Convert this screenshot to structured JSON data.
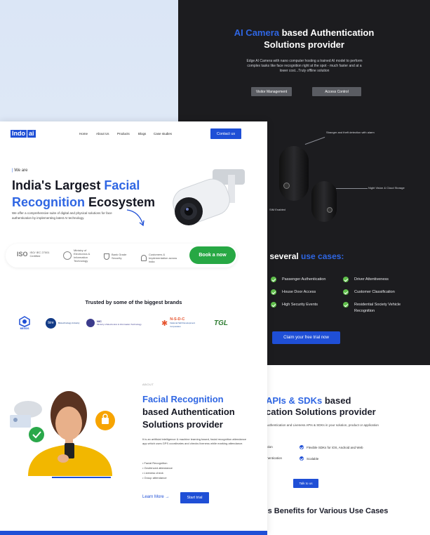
{
  "colors": {
    "accent": "#2f66e3",
    "button": "#1f4fd6",
    "green": "#27a844",
    "dark_bg": "#1c1c1f"
  },
  "back_page": {
    "hero": {
      "title_highlight": "AI Camera",
      "title_rest_line1": " based Authentication",
      "title_line2": "Solutions provider",
      "description": "Edge AI Camera with nano computer hosting a trained AI model to perform complex tasks like face recognition right at the spot - much faster and at a lower cost...Truly offline solution"
    },
    "tabs": [
      "Visitor Management",
      "Access Control"
    ],
    "callouts": {
      "stranger": "Stranger and theft detection with alarm",
      "night": "Night Vision & Cloud Storage",
      "sim": "SIM Enabled"
    },
    "use_cases": {
      "title_prefix": "ur several ",
      "title_highlight": "use cases:",
      "left": [
        "Passenger Authentication",
        "House Door Access",
        "High Security Events"
      ],
      "right": [
        "Driver Attentiveness",
        "Customer Classification",
        "Residential Society Vehicle Recognition"
      ],
      "cta": "Claim your free trial now"
    },
    "apis": {
      "title_line1_highlight": "APIs & SDKs",
      "title_line1_rest": " based",
      "title_line2": "cation Solutions provider",
      "subtitle": "Authentication and Liveness APIs & SDKs in your solution, product or application",
      "features_left": [
        "ation",
        "thentication"
      ],
      "features_right": [
        "Flexible SDKs for iOS, Android and Web",
        "Scalable"
      ],
      "cta": "Talk to us"
    },
    "benefits": {
      "title_rest": "'s Benefits for Various ",
      "title_end": "Use Cases"
    }
  },
  "front_page": {
    "logo": {
      "part1": "Indo",
      "part2": "ai"
    },
    "nav": [
      "Home",
      "About Us",
      "Products",
      "Blogs",
      "Case studies"
    ],
    "contact_button": "Contact us",
    "hero": {
      "eyebrow": "We are",
      "line1": "India's Largest ",
      "line1_highlight": "Facial",
      "line2_highlight": "Recognition",
      "line2_rest": " Ecosystem",
      "subtitle": "We offer a comprehensive suite of digital and physical solutions for face authentication by implementing latest AI technology."
    },
    "trust_badges": [
      {
        "icon": "iso-badge-icon",
        "text": "ISO/ IEC 27001 Certified"
      },
      {
        "icon": "ministry-emblem-icon",
        "text": "Ministry of Electronics & Information Technology"
      },
      {
        "icon": "shield-check-icon",
        "text": "Bank Grade Security"
      },
      {
        "icon": "user-check-icon",
        "text": "Customers & Implementation across india"
      }
    ],
    "book_button": "Book a now",
    "brands_title": "Trusted by some of the biggest brands",
    "brands": [
      {
        "name": "MEGDS"
      },
      {
        "name": "bire",
        "sub": "Biotechnology Industry"
      },
      {
        "name": "NIC",
        "sub": "Ministry of Electronics & Information Technology"
      },
      {
        "name": "N-S-D-C",
        "sub": "National Skill Development Corporation"
      },
      {
        "name": "TGL"
      }
    ],
    "about": {
      "eyebrow": "ABOUT",
      "title_highlight": "Facial Recognition",
      "title_line2": "based Authentication",
      "title_line3": "Solutions provider",
      "description": "It is an artificial intelligence & machine learning based, facial recognition attendance app which uses GPS coordinates and checks liveness while marking attendance.",
      "list": [
        "Facial Recognition",
        "Geofenced attendance",
        "Liveness check",
        "Group attendance"
      ],
      "learn_more": "Learn More",
      "start_trial": "Start trial"
    }
  }
}
